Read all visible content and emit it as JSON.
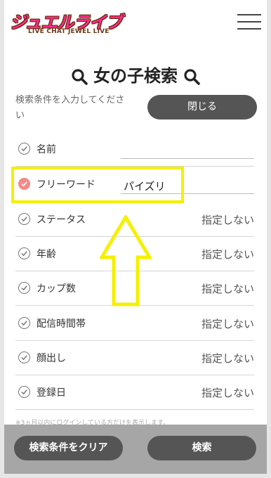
{
  "header": {
    "logo_text": "ジュエルライブ",
    "logo_subtext": "LIVE CHAT JEWEL LIVE"
  },
  "title": "女の子検索",
  "hint": "検索条件を入力してください",
  "close_label": "閉じる",
  "rows": [
    {
      "label": "名前",
      "value": ""
    },
    {
      "label": "フリーワード",
      "value": "パイズリ"
    },
    {
      "label": "ステータス",
      "value": "指定しない"
    },
    {
      "label": "年齢",
      "value": "指定しない"
    },
    {
      "label": "カップ数",
      "value": "指定しない"
    },
    {
      "label": "配信時間帯",
      "value": "指定しない"
    },
    {
      "label": "顔出し",
      "value": "指定しない"
    },
    {
      "label": "登録日",
      "value": "指定しない"
    }
  ],
  "notice": "※3ヵ月以内にログインしている方だけを表示します。",
  "footer": {
    "clear_label": "検索条件をクリア",
    "search_label": "検索"
  },
  "colors": {
    "logo_pink": "#ff2a8c",
    "button_dark": "#555555",
    "highlight_yellow": "#f4f000",
    "active_check": "#f48a8a"
  }
}
